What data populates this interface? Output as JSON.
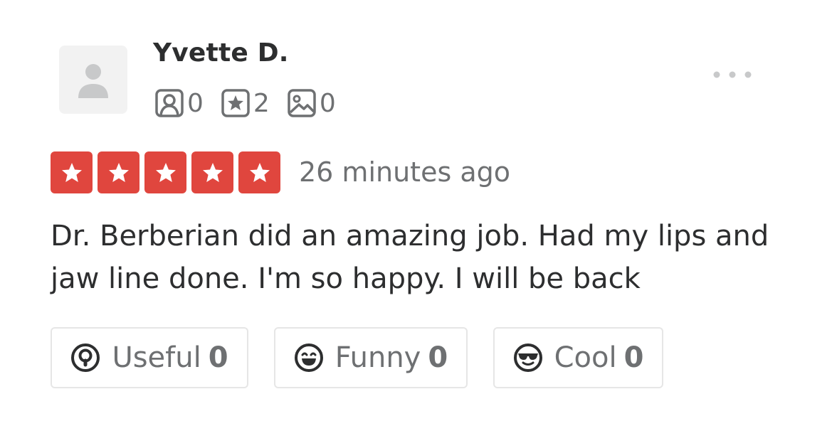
{
  "reviewer": {
    "name": "Yvette D.",
    "stats": {
      "friends": "0",
      "reviews": "2",
      "photos": "0"
    }
  },
  "rating": {
    "stars": 5,
    "max_stars": 5,
    "color": "#e0463e"
  },
  "timestamp": "26 minutes ago",
  "review_text": "Dr. Berberian did an amazing job. Had my lips and jaw line done. I'm so happy. I will be back",
  "reactions": {
    "useful": {
      "label": "Useful",
      "count": "0"
    },
    "funny": {
      "label": "Funny",
      "count": "0"
    },
    "cool": {
      "label": "Cool",
      "count": "0"
    }
  },
  "icons": {
    "friends": "friends-icon",
    "reviews": "review-star-icon",
    "photos": "photo-icon",
    "more": "more-options-icon",
    "useful": "lightbulb-icon",
    "funny": "laughing-face-icon",
    "cool": "sunglasses-face-icon"
  }
}
